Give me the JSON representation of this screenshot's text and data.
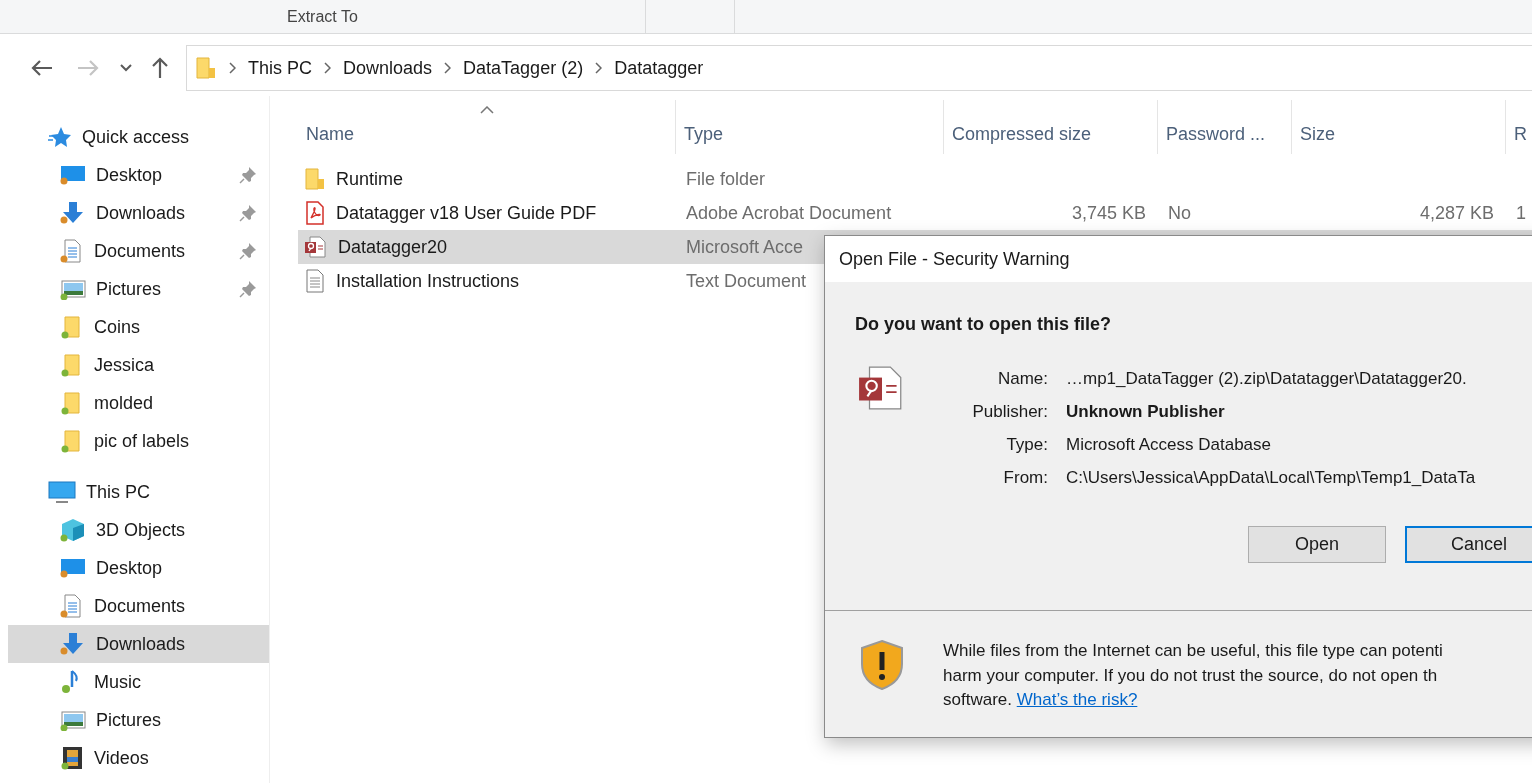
{
  "ribbon": {
    "label": "Extract To"
  },
  "nav": [
    {
      "kind": "back",
      "disabled": false
    },
    {
      "kind": "forward",
      "disabled": true
    },
    {
      "kind": "recent",
      "disabled": false
    },
    {
      "kind": "up",
      "disabled": false
    }
  ],
  "address": {
    "path": [
      "This PC",
      "Downloads",
      "DataTagger (2)",
      "Datatagger"
    ]
  },
  "sidebar": [
    {
      "label": "Quick access",
      "kind": "star",
      "selected": false,
      "children": [
        {
          "label": "Desktop",
          "kind": "desktop",
          "pinned": true,
          "selected": false
        },
        {
          "label": "Downloads",
          "kind": "download",
          "pinned": true,
          "selected": false
        },
        {
          "label": "Documents",
          "kind": "documents",
          "pinned": true,
          "selected": false
        },
        {
          "label": "Pictures",
          "kind": "pictures",
          "pinned": true,
          "selected": false
        },
        {
          "label": "Coins",
          "kind": "folder",
          "pinned": false,
          "selected": false
        },
        {
          "label": "Jessica",
          "kind": "folder",
          "pinned": false,
          "selected": false
        },
        {
          "label": "molded",
          "kind": "folder",
          "pinned": false,
          "selected": false
        },
        {
          "label": "pic of labels",
          "kind": "folder",
          "pinned": false,
          "selected": false
        }
      ]
    },
    {
      "label": "This PC",
      "kind": "pc",
      "selected": false,
      "children": [
        {
          "label": "3D Objects",
          "kind": "cube",
          "pinned": false,
          "selected": false
        },
        {
          "label": "Desktop",
          "kind": "desktop",
          "pinned": false,
          "selected": false
        },
        {
          "label": "Documents",
          "kind": "documents",
          "pinned": false,
          "selected": false
        },
        {
          "label": "Downloads",
          "kind": "download",
          "pinned": false,
          "selected": true
        },
        {
          "label": "Music",
          "kind": "music",
          "pinned": false,
          "selected": false
        },
        {
          "label": "Pictures",
          "kind": "pictures",
          "pinned": false,
          "selected": false
        },
        {
          "label": "Videos",
          "kind": "video",
          "pinned": false,
          "selected": false
        }
      ]
    }
  ],
  "table": {
    "columns": [
      {
        "label": "Name",
        "sorted": true
      },
      {
        "label": "Type",
        "sorted": false
      },
      {
        "label": "Compressed size",
        "sorted": false
      },
      {
        "label": "Password ...",
        "sorted": false
      },
      {
        "label": "Size",
        "sorted": false
      },
      {
        "label": "R",
        "sorted": false
      }
    ],
    "rows": [
      {
        "kind": "folder",
        "selected": false,
        "cells": [
          "Runtime",
          "File folder"
        ]
      },
      {
        "kind": "pdf",
        "selected": false,
        "cells": [
          "Datatagger v18 User Guide PDF",
          "Adobe Acrobat Document",
          "3,745 KB",
          "No",
          "4,287 KB",
          "1"
        ]
      },
      {
        "kind": "access",
        "selected": true,
        "cells": [
          "Datatagger20",
          "Microsoft Acce"
        ]
      },
      {
        "kind": "text",
        "selected": false,
        "cells": [
          "Installation Instructions",
          "Text Document"
        ]
      }
    ]
  },
  "dialog": {
    "title": "Open File - Security Warning",
    "question": "Do you want to open this file?",
    "fields": [
      {
        "label": "Name:",
        "value": "…mp1_DataTagger (2).zip\\Datatagger\\Datatagger20.",
        "bold": false
      },
      {
        "label": "Publisher:",
        "value": "Unknown Publisher",
        "bold": true
      },
      {
        "label": "Type:",
        "value": "Microsoft Access Database",
        "bold": false
      },
      {
        "label": "From:",
        "value": "C:\\Users\\Jessica\\AppData\\Local\\Temp\\Temp1_DataTa",
        "bold": false
      }
    ],
    "buttons": [
      {
        "label": "Open",
        "default": false
      },
      {
        "label": "Cancel",
        "default": true
      }
    ],
    "warning": {
      "lines": [
        "While files from the Internet can be useful, this file type can potenti",
        "harm your computer. If you do not trust the source, do not open th",
        "software."
      ],
      "link": "What’s the risk?"
    }
  }
}
